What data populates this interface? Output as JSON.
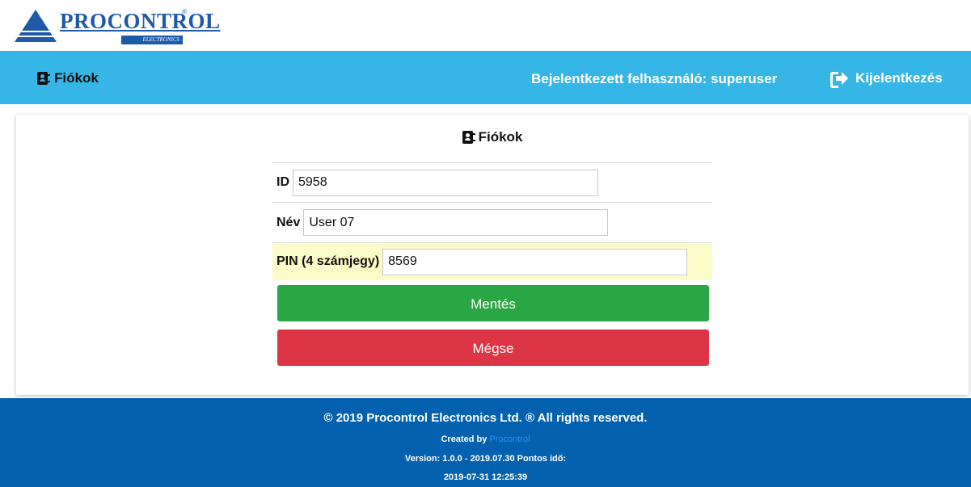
{
  "logo": {
    "name": "PROCONTROL",
    "registered": "®",
    "sub": "ELECTRONICS"
  },
  "topbar": {
    "title": "Fiókok",
    "title_icon": "address-book-icon",
    "user_info": "Bejelentkezett felhasználó: superuser",
    "logout_label": "Kijelentkezés",
    "logout_icon": "sign-out-icon",
    "color": "#35b6e6"
  },
  "card": {
    "title": "Fiókok"
  },
  "form": {
    "id_label": "ID",
    "id_value": "5958",
    "name_label": "Név",
    "name_value": "User 07",
    "pin_label": "PIN (4 számjegy)",
    "pin_value": "8569",
    "pin_row_color": "#fbfcc8",
    "save_label": "Mentés",
    "save_color": "#29a744",
    "cancel_label": "Mégse",
    "cancel_color": "#dc3545"
  },
  "footer": {
    "copyright": "© 2019 Procontrol Electronics Ltd. ® All rights reserved.",
    "created_by": "Created by",
    "created_link": "Procontrol",
    "version": "Version: 1.0.0 - 2019.07.30 Pontos idő:",
    "time": "2019-07-31 12:25:39",
    "color": "#0461af"
  }
}
